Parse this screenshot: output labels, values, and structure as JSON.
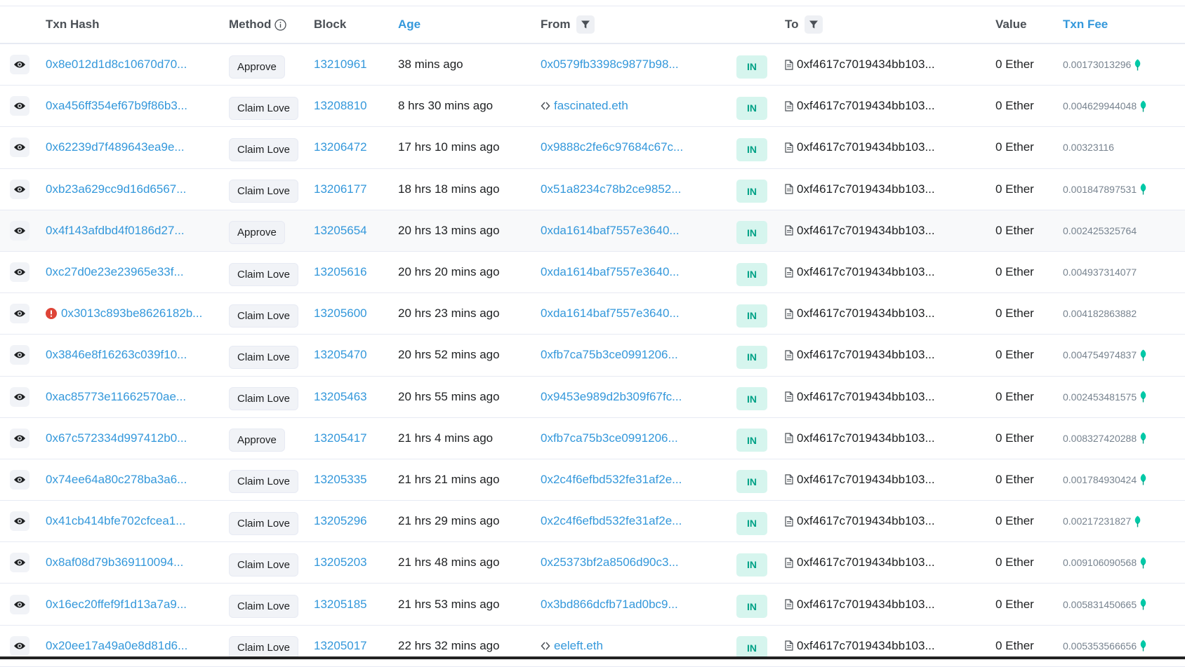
{
  "headers": {
    "txn_hash": "Txn Hash",
    "method": "Method",
    "block": "Block",
    "age": "Age",
    "from": "From",
    "to": "To",
    "value": "Value",
    "txn_fee": "Txn Fee"
  },
  "colors": {
    "link": "#3498db",
    "in_badge_bg": "#d6f5ee",
    "in_badge_text": "#00a186",
    "error": "#de4437",
    "leaf": "#00c9a7"
  },
  "rows": [
    {
      "hash": "0x8e012d1d8c10670d70...",
      "method": "Approve",
      "block": "13210961",
      "age": "38 mins ago",
      "from": "0x0579fb3398c9877b98...",
      "direction": "IN",
      "to": "0xf4617c7019434bb103...",
      "value": "0 Ether",
      "fee": "0.00173013296",
      "leaf": true,
      "error": false,
      "ens": false
    },
    {
      "hash": "0xa456ff354ef67b9f86b3...",
      "method": "Claim Love",
      "block": "13208810",
      "age": "8 hrs 30 mins ago",
      "from": "fascinated.eth",
      "direction": "IN",
      "to": "0xf4617c7019434bb103...",
      "value": "0 Ether",
      "fee": "0.004629944048",
      "leaf": true,
      "error": false,
      "ens": true
    },
    {
      "hash": "0x62239d7f489643ea9e...",
      "method": "Claim Love",
      "block": "13206472",
      "age": "17 hrs 10 mins ago",
      "from": "0x9888c2fe6c97684c67c...",
      "direction": "IN",
      "to": "0xf4617c7019434bb103...",
      "value": "0 Ether",
      "fee": "0.00323116",
      "leaf": false,
      "error": false,
      "ens": false
    },
    {
      "hash": "0xb23a629cc9d16d6567...",
      "method": "Claim Love",
      "block": "13206177",
      "age": "18 hrs 18 mins ago",
      "from": "0x51a8234c78b2ce9852...",
      "direction": "IN",
      "to": "0xf4617c7019434bb103...",
      "value": "0 Ether",
      "fee": "0.001847897531",
      "leaf": true,
      "error": false,
      "ens": false
    },
    {
      "hash": "0x4f143afdbd4f0186d27...",
      "method": "Approve",
      "block": "13205654",
      "age": "20 hrs 13 mins ago",
      "from": "0xda1614baf7557e3640...",
      "direction": "IN",
      "to": "0xf4617c7019434bb103...",
      "value": "0 Ether",
      "fee": "0.002425325764",
      "leaf": false,
      "error": false,
      "ens": false,
      "highlight": true
    },
    {
      "hash": "0xc27d0e23e23965e33f...",
      "method": "Claim Love",
      "block": "13205616",
      "age": "20 hrs 20 mins ago",
      "from": "0xda1614baf7557e3640...",
      "direction": "IN",
      "to": "0xf4617c7019434bb103...",
      "value": "0 Ether",
      "fee": "0.004937314077",
      "leaf": false,
      "error": false,
      "ens": false
    },
    {
      "hash": "0x3013c893be8626182b...",
      "method": "Claim Love",
      "block": "13205600",
      "age": "20 hrs 23 mins ago",
      "from": "0xda1614baf7557e3640...",
      "direction": "IN",
      "to": "0xf4617c7019434bb103...",
      "value": "0 Ether",
      "fee": "0.004182863882",
      "leaf": false,
      "error": true,
      "ens": false
    },
    {
      "hash": "0x3846e8f16263c039f10...",
      "method": "Claim Love",
      "block": "13205470",
      "age": "20 hrs 52 mins ago",
      "from": "0xfb7ca75b3ce0991206...",
      "direction": "IN",
      "to": "0xf4617c7019434bb103...",
      "value": "0 Ether",
      "fee": "0.004754974837",
      "leaf": true,
      "error": false,
      "ens": false
    },
    {
      "hash": "0xac85773e11662570ae...",
      "method": "Claim Love",
      "block": "13205463",
      "age": "20 hrs 55 mins ago",
      "from": "0x9453e989d2b309f67fc...",
      "direction": "IN",
      "to": "0xf4617c7019434bb103...",
      "value": "0 Ether",
      "fee": "0.002453481575",
      "leaf": true,
      "error": false,
      "ens": false
    },
    {
      "hash": "0x67c572334d997412b0...",
      "method": "Approve",
      "block": "13205417",
      "age": "21 hrs 4 mins ago",
      "from": "0xfb7ca75b3ce0991206...",
      "direction": "IN",
      "to": "0xf4617c7019434bb103...",
      "value": "0 Ether",
      "fee": "0.008327420288",
      "leaf": true,
      "error": false,
      "ens": false
    },
    {
      "hash": "0x74ee64a80c278ba3a6...",
      "method": "Claim Love",
      "block": "13205335",
      "age": "21 hrs 21 mins ago",
      "from": "0x2c4f6efbd532fe31af2e...",
      "direction": "IN",
      "to": "0xf4617c7019434bb103...",
      "value": "0 Ether",
      "fee": "0.001784930424",
      "leaf": true,
      "error": false,
      "ens": false
    },
    {
      "hash": "0x41cb414bfe702cfcea1...",
      "method": "Claim Love",
      "block": "13205296",
      "age": "21 hrs 29 mins ago",
      "from": "0x2c4f6efbd532fe31af2e...",
      "direction": "IN",
      "to": "0xf4617c7019434bb103...",
      "value": "0 Ether",
      "fee": "0.00217231827",
      "leaf": true,
      "error": false,
      "ens": false
    },
    {
      "hash": "0x8af08d79b369110094...",
      "method": "Claim Love",
      "block": "13205203",
      "age": "21 hrs 48 mins ago",
      "from": "0x25373bf2a8506d90c3...",
      "direction": "IN",
      "to": "0xf4617c7019434bb103...",
      "value": "0 Ether",
      "fee": "0.009106090568",
      "leaf": true,
      "error": false,
      "ens": false
    },
    {
      "hash": "0x16ec20ffef9f1d13a7a9...",
      "method": "Claim Love",
      "block": "13205185",
      "age": "21 hrs 53 mins ago",
      "from": "0x3bd866dcfb71ad0bc9...",
      "direction": "IN",
      "to": "0xf4617c7019434bb103...",
      "value": "0 Ether",
      "fee": "0.005831450665",
      "leaf": true,
      "error": false,
      "ens": false
    },
    {
      "hash": "0x20ee17a49a0e8d81d6...",
      "method": "Claim Love",
      "block": "13205017",
      "age": "22 hrs 32 mins ago",
      "from": "eeleft.eth",
      "direction": "IN",
      "to": "0xf4617c7019434bb103...",
      "value": "0 Ether",
      "fee": "0.005353566656",
      "leaf": true,
      "error": false,
      "ens": true
    }
  ]
}
